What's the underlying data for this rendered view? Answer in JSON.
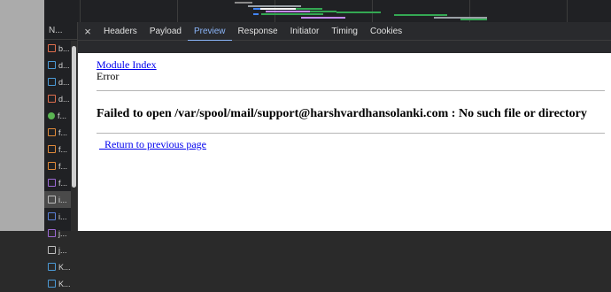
{
  "sidebar": {
    "header": "N...",
    "items": [
      {
        "label": "b...",
        "icon": "html-icon"
      },
      {
        "label": "d...",
        "icon": "text-icon"
      },
      {
        "label": "d...",
        "icon": "text-icon"
      },
      {
        "label": "d...",
        "icon": "html-icon"
      },
      {
        "label": "f...",
        "icon": "png-icon"
      },
      {
        "label": "f...",
        "icon": "js-icon"
      },
      {
        "label": "f...",
        "icon": "js-icon"
      },
      {
        "label": "f...",
        "icon": "js-icon"
      },
      {
        "label": "f...",
        "icon": "image-icon"
      },
      {
        "label": "i...",
        "icon": "document-icon"
      },
      {
        "label": "i...",
        "icon": "css-icon"
      },
      {
        "label": "j...",
        "icon": "image-icon"
      },
      {
        "label": "j...",
        "icon": "document-icon"
      },
      {
        "label": "K...",
        "icon": "font-icon"
      },
      {
        "label": "K...",
        "icon": "font-icon"
      }
    ]
  },
  "tabs": {
    "close": "×",
    "items": [
      "Headers",
      "Payload",
      "Preview",
      "Response",
      "Initiator",
      "Timing",
      "Cookies"
    ],
    "active": "Preview"
  },
  "preview": {
    "module_link": "Module Index",
    "error_label": "Error",
    "message": "Failed to open /var/spool/mail/support@harshvardhansolanki.com : No such file or directory",
    "return_link": "  Return to previous page"
  }
}
